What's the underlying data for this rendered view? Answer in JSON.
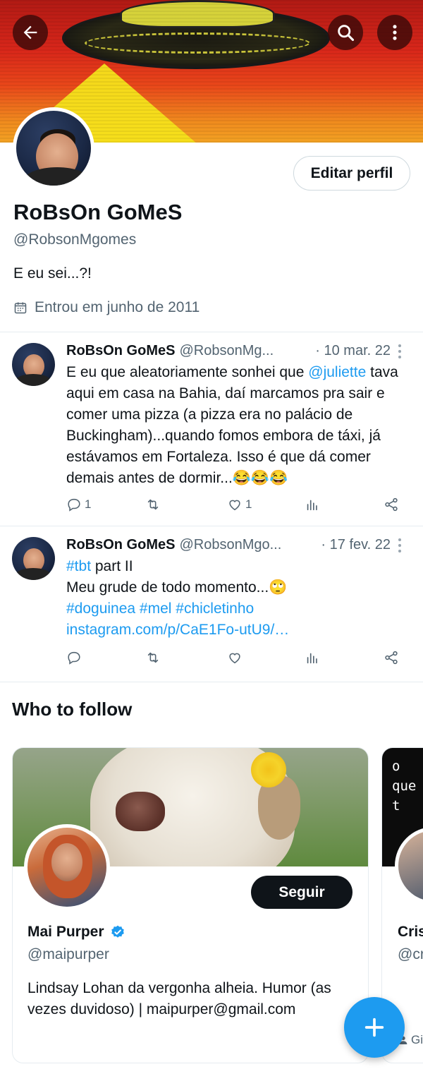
{
  "profile": {
    "name": "RoBsOn GoMeS",
    "handle": "@RobsonMgomes",
    "bio": "E eu sei...?!",
    "joined": "Entrou em junho de 2011",
    "edit_label": "Editar perfil"
  },
  "header": {
    "back_icon": "arrow-left-icon",
    "search_icon": "search-icon",
    "more_icon": "more-vertical-icon"
  },
  "tweets": [
    {
      "name": "RoBsOn GoMeS",
      "handle": "@RobsonMg...",
      "date": "· 10 mar. 22",
      "body_pre": "E eu que aleatoriamente sonhei que ",
      "mention": "@juliette",
      "body_post": " tava aqui em casa na Bahia, daí marcamos pra sair e comer uma pizza (a pizza era no palácio de Buckingham)...quando fomos embora de táxi, já estávamos em Fortaleza. Isso é que dá comer demais antes de dormir...😂😂😂",
      "replies": "1",
      "retweets": "",
      "likes": "1"
    },
    {
      "name": "RoBsOn GoMeS",
      "handle": "@RobsonMgo...",
      "date": "· 17 fev. 22",
      "hashtag1": "#tbt",
      "line1_rest": " part II",
      "line2": "Meu grude de todo momento...🙄",
      "hashtags": "#doguinea #mel #chicletinho",
      "link": "instagram.com/p/CaE1Fo-utU9/…",
      "replies": "",
      "retweets": "",
      "likes": ""
    }
  ],
  "who_to_follow": {
    "title": "Who to follow",
    "cards": [
      {
        "name": "Mai Purper",
        "handle": "@maipurper",
        "bio": "Lindsay Lohan da vergonha alheia. Humor (as vezes duvidoso) | maipurper@gmail.com",
        "follow_label": "Seguir",
        "verified": true
      },
      {
        "name": "Cris",
        "handle": "@cr",
        "cover_text": "o\nque\nt",
        "footer": "Gi"
      }
    ]
  },
  "colors": {
    "accent": "#1d9bf0",
    "text": "#0f1419",
    "muted": "#536471"
  }
}
